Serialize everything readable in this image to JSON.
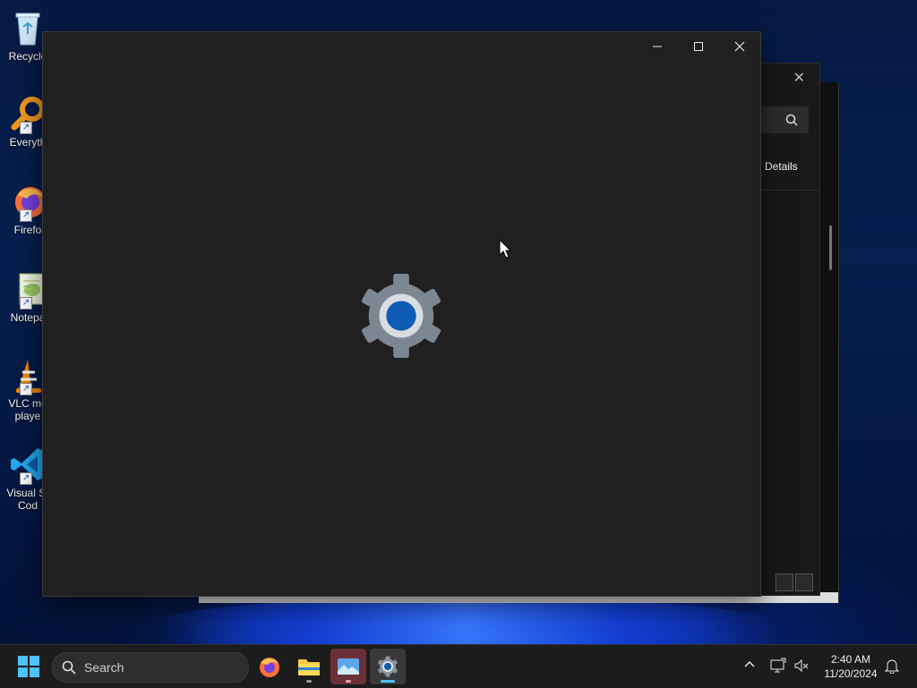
{
  "desktop": {
    "icons": [
      {
        "label": "Recycle",
        "icon": "recycle-bin-icon"
      },
      {
        "label": "Everyth",
        "icon": "everything-search-icon"
      },
      {
        "label": "Firefo",
        "icon": "firefox-icon"
      },
      {
        "label": "Notepa",
        "icon": "notepad-plus-plus-icon"
      },
      {
        "label": "VLC me",
        "label2": "playe",
        "icon": "vlc-icon"
      },
      {
        "label": "Visual St",
        "label2": "Cod",
        "icon": "vscode-icon"
      }
    ]
  },
  "background_window": {
    "close_glyph": "✕",
    "details_label": "Details"
  },
  "main_window": {
    "minimize_glyph": "—",
    "maximize_glyph": "☐",
    "close_glyph": "✕",
    "splash_icon": "settings-gear-icon"
  },
  "taskbar": {
    "search_label": "Search",
    "apps": [
      "firefox-icon",
      "file-explorer-icon",
      "photos-icon",
      "settings-icon"
    ],
    "tray": {
      "chevron": "^",
      "time": "2:40 AM",
      "date": "11/20/2024"
    }
  },
  "colors": {
    "accent_blue": "#0067c0",
    "taskbar_bg": "#1c1c1c",
    "window_bg": "#202020"
  }
}
